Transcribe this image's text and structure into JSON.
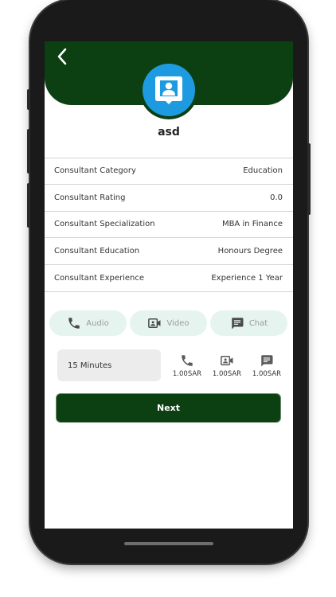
{
  "profile": {
    "name": "asd"
  },
  "details": [
    {
      "label": "Consultant Category",
      "value": "Education"
    },
    {
      "label": "Consultant Rating",
      "value": "0.0"
    },
    {
      "label": "Consultant Specialization",
      "value": "MBA in Finance"
    },
    {
      "label": "Consultant Education",
      "value": "Honours Degree"
    },
    {
      "label": "Consultant Experience",
      "value": "Experience 1 Year"
    }
  ],
  "tabs": [
    {
      "label": "Audio",
      "icon": "phone-icon"
    },
    {
      "label": "Video",
      "icon": "video-icon"
    },
    {
      "label": "Chat",
      "icon": "chat-icon"
    }
  ],
  "duration": {
    "value": "15 Minutes"
  },
  "prices": [
    {
      "icon": "phone-icon",
      "amount": "1.00SAR"
    },
    {
      "icon": "video-icon",
      "amount": "1.00SAR"
    },
    {
      "icon": "chat-icon",
      "amount": "1.00SAR"
    }
  ],
  "actions": {
    "next_label": "Next"
  },
  "colors": {
    "brand_green": "#0c3f12",
    "avatar_blue": "#1e9be0",
    "tab_bg": "#e6f4ef"
  }
}
